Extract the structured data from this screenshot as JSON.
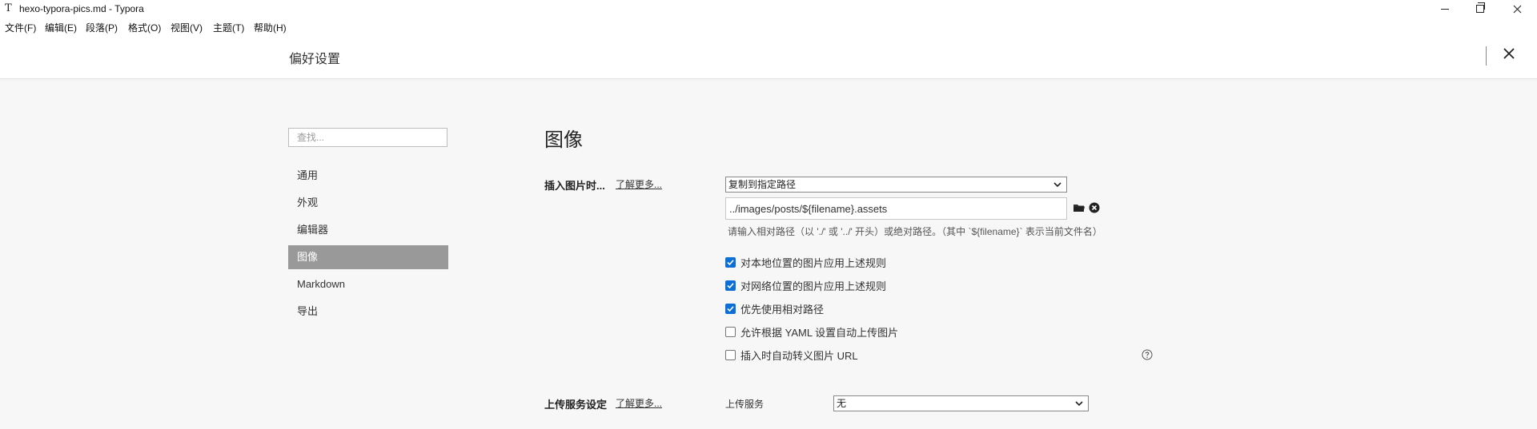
{
  "window": {
    "app_icon": "T",
    "title": "hexo-typora-pics.md - Typora"
  },
  "menu": [
    "文件(F)",
    "编辑(E)",
    "段落(P)",
    "格式(O)",
    "视图(V)",
    "主题(T)",
    "帮助(H)"
  ],
  "header": {
    "title": "偏好设置"
  },
  "sidebar": {
    "search_placeholder": "查找...",
    "items": [
      {
        "label": "通用"
      },
      {
        "label": "外观"
      },
      {
        "label": "编辑器"
      },
      {
        "label": "图像",
        "active": true
      },
      {
        "label": "Markdown"
      },
      {
        "label": "导出"
      }
    ]
  },
  "content": {
    "section_title": "图像",
    "insert": {
      "label": "插入图片时...",
      "learn_more": "了解更多...",
      "action_selected": "复制到指定路径",
      "path_value": "../images/posts/${filename}.assets",
      "hint": "请输入相对路径（以 './' 或 '../' 开头）或绝对路径。（其中 `${filename}` 表示当前文件名）"
    },
    "checkboxes": [
      {
        "label": "对本地位置的图片应用上述规则",
        "checked": true
      },
      {
        "label": "对网络位置的图片应用上述规则",
        "checked": true
      },
      {
        "label": "优先使用相对路径",
        "checked": true
      },
      {
        "label": "允许根据 YAML 设置自动上传图片",
        "checked": false
      },
      {
        "label": "插入时自动转义图片 URL",
        "checked": false
      }
    ],
    "upload": {
      "label": "上传服务设定",
      "learn_more": "了解更多...",
      "service_label": "上传服务",
      "service_selected": "无"
    }
  },
  "colors": {
    "checkbox_accent": "#0b6fd6",
    "active_nav": "#999999"
  }
}
